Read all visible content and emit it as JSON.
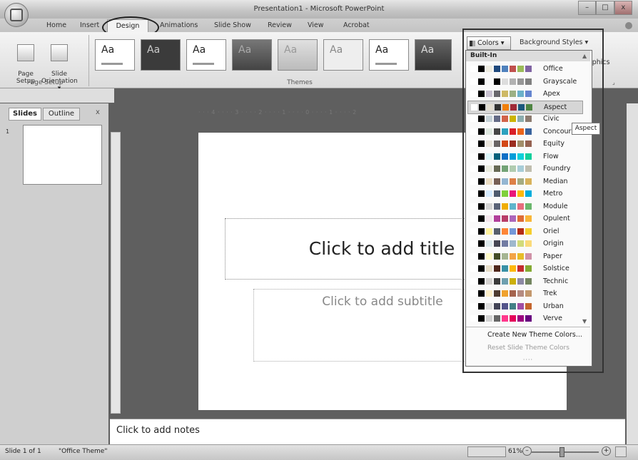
{
  "window": {
    "title": "Presentation1 - Microsoft PowerPoint",
    "controls": [
      "–",
      "□",
      "x"
    ]
  },
  "tabs": [
    "Home",
    "Insert",
    "Design",
    "Animations",
    "Slide Show",
    "Review",
    "View",
    "Acrobat"
  ],
  "active_tab": "Design",
  "ribbon": {
    "page_setup": {
      "label": "Page\nSetup",
      "orientation": "Slide\nOrientation ▾",
      "group": "Page Setup"
    },
    "themes": {
      "sample": "Aa",
      "group": "Themes"
    },
    "colors_button": "Colors ▾",
    "background_styles": "Background Styles ▾",
    "graphics": "raphics"
  },
  "panel": {
    "tab_slides": "Slides",
    "tab_outline": "Outline",
    "close": "x",
    "thumb_number": "1"
  },
  "hruler": "· · · 4 · · · · 3 · · · · 2 · · · · 1 · · · · 0 · · · · 1 · · · · 2",
  "slide": {
    "title_placeholder": "Click to add title",
    "subtitle_placeholder": "Click to add subtitle"
  },
  "notes": {
    "placeholder": "Click to add notes"
  },
  "status": {
    "slide": "Slide 1 of 1",
    "theme": "\"Office Theme\"",
    "zoom": "61%",
    "minus": "–",
    "plus": "+"
  },
  "colors_menu": {
    "header": "Built-In",
    "items": [
      {
        "label": "Office",
        "colors": [
          "#ffffff",
          "#000000",
          "#eeece1",
          "#1f497d",
          "#4f81bd",
          "#c0504d",
          "#9bbb59",
          "#8064a2"
        ]
      },
      {
        "label": "Grayscale",
        "colors": [
          "#ffffff",
          "#000000",
          "#f8f8f8",
          "#000000",
          "#dddddd",
          "#b2b2b2",
          "#969696",
          "#808080"
        ]
      },
      {
        "label": "Apex",
        "colors": [
          "#ffffff",
          "#000000",
          "#c9c2d1",
          "#69676d",
          "#ceb966",
          "#9cb084",
          "#6bb1c9",
          "#6585cf"
        ]
      },
      {
        "label": "Aspect",
        "colors": [
          "#ffffff",
          "#000000",
          "#e3ded1",
          "#323232",
          "#f07f09",
          "#9f2936",
          "#1b587c",
          "#4e8542"
        ]
      },
      {
        "label": "Civic",
        "colors": [
          "#ffffff",
          "#000000",
          "#c5d1d7",
          "#646b86",
          "#d16349",
          "#ccb400",
          "#8cadae",
          "#8c7b70"
        ]
      },
      {
        "label": "Concourse",
        "colors": [
          "#ffffff",
          "#000000",
          "#dee8e0",
          "#464646",
          "#2da2bf",
          "#da1f28",
          "#eb641b",
          "#39639d"
        ]
      },
      {
        "label": "Equity",
        "colors": [
          "#ffffff",
          "#000000",
          "#e9e5dc",
          "#696464",
          "#d34817",
          "#9b2d1f",
          "#a28e6a",
          "#956251"
        ]
      },
      {
        "label": "Flow",
        "colors": [
          "#ffffff",
          "#000000",
          "#dbf5f9",
          "#04617b",
          "#0f6fc6",
          "#009dd9",
          "#0bd0d9",
          "#10cf9b"
        ]
      },
      {
        "label": "Foundry",
        "colors": [
          "#ffffff",
          "#000000",
          "#eaebde",
          "#676a55",
          "#72a376",
          "#b0ccb0",
          "#a8cdd7",
          "#c0beaf"
        ]
      },
      {
        "label": "Median",
        "colors": [
          "#ffffff",
          "#000000",
          "#ebddc3",
          "#775f55",
          "#94b6d2",
          "#dd8047",
          "#a5ab81",
          "#d8b25c"
        ]
      },
      {
        "label": "Metro",
        "colors": [
          "#ffffff",
          "#000000",
          "#d6ecff",
          "#4e5b6f",
          "#7fd13b",
          "#ea157a",
          "#feb80a",
          "#00addc"
        ]
      },
      {
        "label": "Module",
        "colors": [
          "#ffffff",
          "#000000",
          "#d4d4d4",
          "#5a6378",
          "#f0ad00",
          "#60b5cc",
          "#e66c7d",
          "#6bb76d"
        ]
      },
      {
        "label": "Opulent",
        "colors": [
          "#ffffff",
          "#000000",
          "#f4e7ed",
          "#b13f9a",
          "#b83d68",
          "#ac66bb",
          "#de6c36",
          "#f9b639"
        ]
      },
      {
        "label": "Oriel",
        "colors": [
          "#ffffff",
          "#000000",
          "#fff39d",
          "#575f6d",
          "#fe8637",
          "#7598d9",
          "#b32c16",
          "#f5cd2d"
        ]
      },
      {
        "label": "Origin",
        "colors": [
          "#ffffff",
          "#000000",
          "#dde9ec",
          "#464653",
          "#727ca3",
          "#9fb8cd",
          "#d2da7a",
          "#fada7a"
        ]
      },
      {
        "label": "Paper",
        "colors": [
          "#ffffff",
          "#000000",
          "#fefac9",
          "#444d26",
          "#a5b592",
          "#f3a447",
          "#e7bc29",
          "#d092a7"
        ]
      },
      {
        "label": "Solstice",
        "colors": [
          "#ffffff",
          "#000000",
          "#e7dec9",
          "#4f271c",
          "#3891a7",
          "#feb80a",
          "#c32d2e",
          "#84aa33"
        ]
      },
      {
        "label": "Technic",
        "colors": [
          "#ffffff",
          "#000000",
          "#d4d2d0",
          "#3b3b3b",
          "#6ea0b0",
          "#ccaf0a",
          "#8d89a4",
          "#748560"
        ]
      },
      {
        "label": "Trek",
        "colors": [
          "#ffffff",
          "#000000",
          "#fbeec9",
          "#4e3b30",
          "#f0a22e",
          "#a5644e",
          "#b58b80",
          "#c3986d"
        ]
      },
      {
        "label": "Urban",
        "colors": [
          "#ffffff",
          "#000000",
          "#dedede",
          "#424456",
          "#53548a",
          "#438086",
          "#a04da3",
          "#c4652d"
        ]
      },
      {
        "label": "Verve",
        "colors": [
          "#ffffff",
          "#000000",
          "#d2d2d2",
          "#666666",
          "#ff388c",
          "#e40059",
          "#9c007f",
          "#68007f"
        ]
      }
    ],
    "highlighted": "Aspect",
    "tooltip": "Aspect",
    "create_new": "Create New Theme Colors...",
    "reset": "Reset Slide Theme Colors",
    "grip": "····"
  }
}
